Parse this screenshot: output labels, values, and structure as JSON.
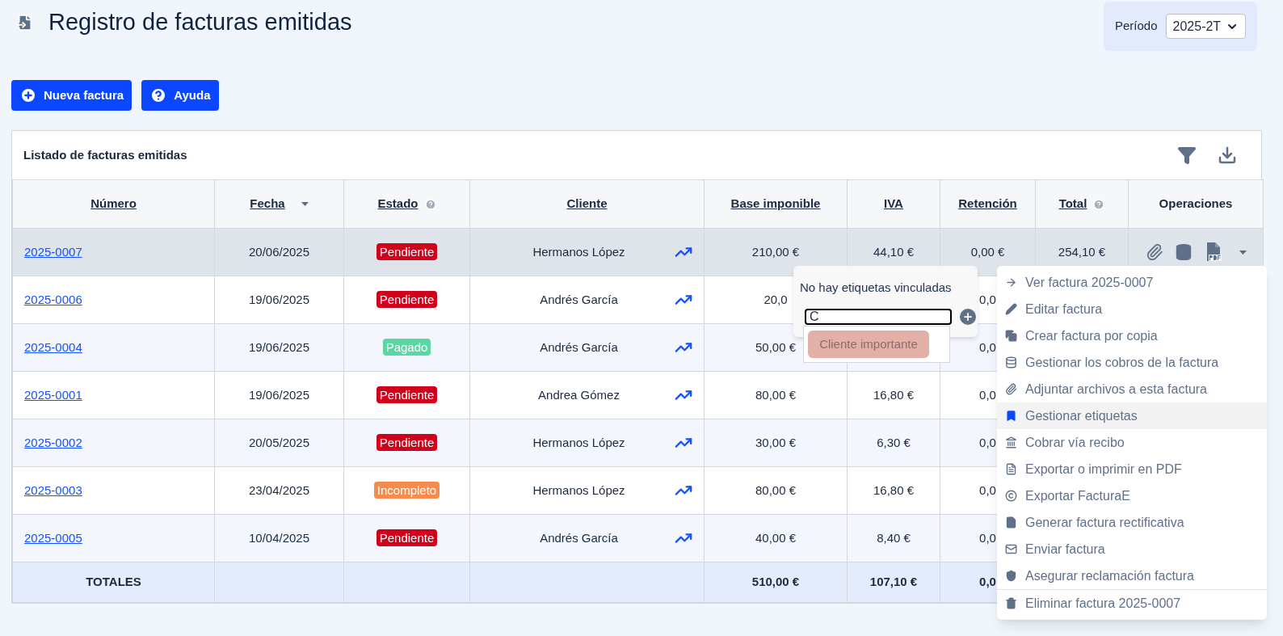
{
  "page": {
    "title": "Registro de facturas emitidas"
  },
  "period": {
    "label": "Período",
    "value": "2025-2T"
  },
  "actions": [
    {
      "label": "Nueva factura",
      "kind": "add"
    },
    {
      "label": "Ayuda",
      "kind": "help"
    }
  ],
  "table": {
    "title": "Listado de facturas emitidas",
    "columns": [
      {
        "label": "Número",
        "sortable": true,
        "sorted": false,
        "help": false
      },
      {
        "label": "Fecha",
        "sortable": true,
        "sorted": true,
        "help": false
      },
      {
        "label": "Estado",
        "sortable": true,
        "sorted": false,
        "help": true
      },
      {
        "label": "Cliente",
        "sortable": true,
        "sorted": false,
        "help": false
      },
      {
        "label": "Base imponible",
        "sortable": true,
        "sorted": false,
        "help": false
      },
      {
        "label": "IVA",
        "sortable": true,
        "sorted": false,
        "help": false
      },
      {
        "label": "Retención",
        "sortable": true,
        "sorted": false,
        "help": false
      },
      {
        "label": "Total",
        "sortable": true,
        "sorted": false,
        "help": true
      },
      {
        "label": "Operaciones",
        "sortable": false,
        "sorted": false,
        "help": false
      }
    ],
    "rows": [
      {
        "number": "2025-0007",
        "date": "20/06/2025",
        "status": "Pendiente",
        "color": "#d0021b",
        "client": "Hermanos López",
        "base": "210,00 €",
        "iva": "44,10 €",
        "retention": "0,00 €",
        "total": "254,10 €",
        "operations": true,
        "selected": true
      },
      {
        "number": "2025-0006",
        "date": "19/06/2025",
        "status": "Pendiente",
        "color": "#d0021b",
        "client": "Andrés García",
        "base": "20,0",
        "retention": "0,0",
        "selected": false
      },
      {
        "number": "2025-0004",
        "date": "19/06/2025",
        "status": "Pagado",
        "color": "#5cd6a3",
        "client": "Andrés García",
        "base": "50,00 €",
        "retention": "0,0",
        "selected": false
      },
      {
        "number": "2025-0001",
        "date": "19/06/2025",
        "status": "Pendiente",
        "color": "#d0021b",
        "client": "Andrea Gómez",
        "base": "80,00 €",
        "iva": "16,80 €",
        "retention": "0,0",
        "selected": false
      },
      {
        "number": "2025-0002",
        "date": "20/05/2025",
        "status": "Pendiente",
        "color": "#d0021b",
        "client": "Hermanos López",
        "base": "30,00 €",
        "iva": "6,30 €",
        "retention": "0,0",
        "selected": false
      },
      {
        "number": "2025-0003",
        "date": "23/04/2025",
        "status": "Incompleto",
        "color": "#f58b4c",
        "client": "Hermanos López",
        "base": "80,00 €",
        "iva": "16,80 €",
        "retention": "0,0",
        "selected": false
      },
      {
        "number": "2025-0005",
        "date": "10/04/2025",
        "status": "Pendiente",
        "color": "#d0021b",
        "client": "Andrés García",
        "base": "40,00 €",
        "iva": "8,40 €",
        "retention": "0,0",
        "selected": false
      }
    ],
    "totals": {
      "label": "TOTALES",
      "base": "510,00 €",
      "iva": "107,10 €",
      "retention": "0,0"
    }
  },
  "tags_popover": {
    "message": "No hay etiquetas vinculadas",
    "value": "C",
    "suggestion": "Cliente importante"
  },
  "menu": [
    {
      "label": "Ver factura 2025-0007",
      "kind": "normal",
      "selected": false
    },
    {
      "label": "Editar factura",
      "kind": "normal",
      "selected": false
    },
    {
      "label": "Crear factura por copia",
      "kind": "normal",
      "selected": false
    },
    {
      "label": "Gestionar los cobros de la factura",
      "kind": "normal",
      "selected": false
    },
    {
      "label": "Adjuntar archivos a esta factura",
      "kind": "normal",
      "selected": false
    },
    {
      "label": "Gestionar etiquetas",
      "kind": "normal",
      "selected": true
    },
    {
      "label": "Cobrar vía recibo",
      "kind": "normal",
      "selected": false
    },
    {
      "label": "Exportar o imprimir en PDF",
      "kind": "normal",
      "selected": false
    },
    {
      "label": "Exportar FacturaE",
      "kind": "normal",
      "selected": false
    },
    {
      "label": "Generar factura rectificativa",
      "kind": "normal",
      "selected": false
    },
    {
      "label": "Enviar factura",
      "kind": "normal",
      "selected": false
    },
    {
      "label": "Asegurar reclamación factura",
      "kind": "normal",
      "selected": false
    },
    {
      "label": "Eliminar factura 2025-0007",
      "kind": "separated",
      "selected": false
    }
  ]
}
